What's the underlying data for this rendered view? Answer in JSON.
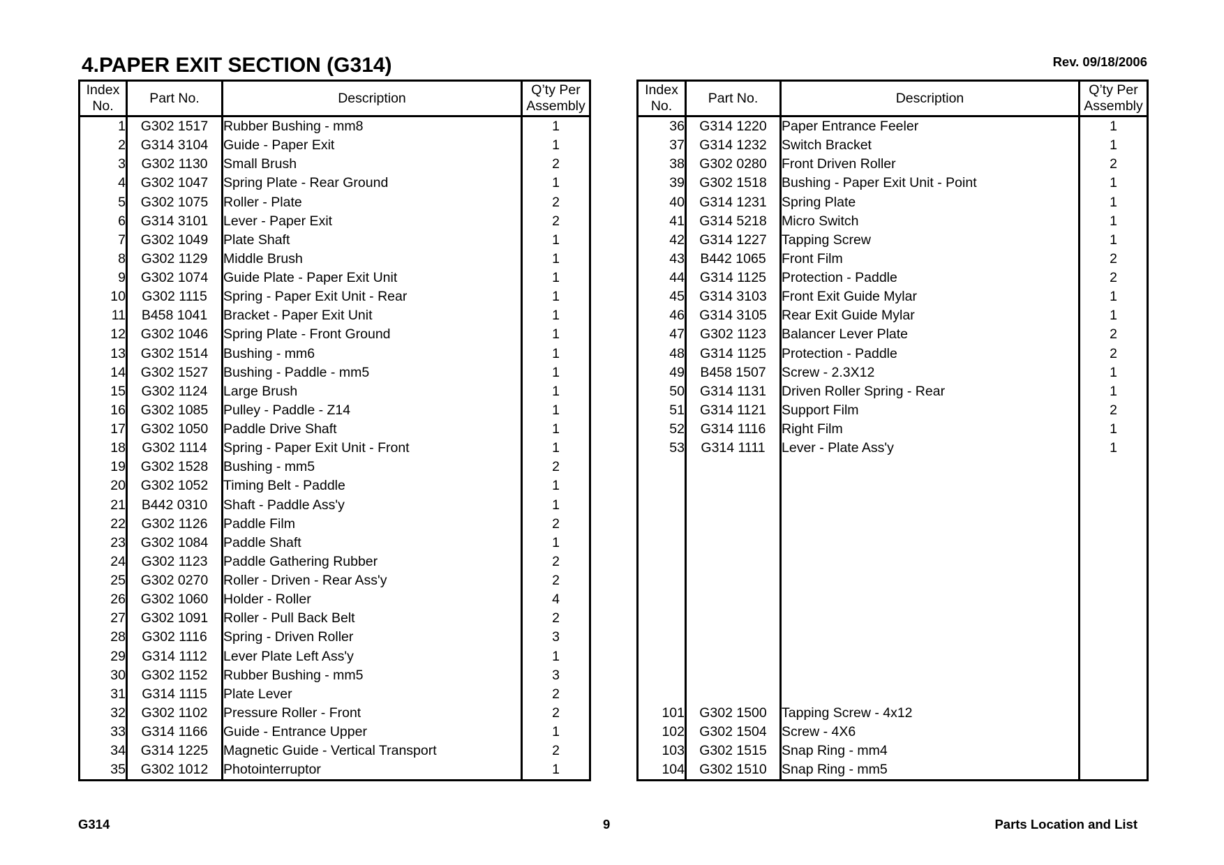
{
  "header": {
    "title": "4.PAPER EXIT SECTION (G314)",
    "revision": "Rev. 09/18/2006"
  },
  "columns": {
    "index": [
      "Index",
      "No."
    ],
    "part_no": "Part No.",
    "description": "Description",
    "qty": [
      "Q’ty Per",
      "Assembly"
    ]
  },
  "left_table": {
    "rows": [
      {
        "index": "1",
        "part_no": "G302 1517",
        "description": "Rubber Bushing - mm8",
        "qty": "1"
      },
      {
        "index": "2",
        "part_no": "G314 3104",
        "description": "Guide - Paper Exit",
        "qty": "1"
      },
      {
        "index": "3",
        "part_no": "G302 1130",
        "description": "Small Brush",
        "qty": "2"
      },
      {
        "index": "4",
        "part_no": "G302 1047",
        "description": "Spring Plate - Rear Ground",
        "qty": "1"
      },
      {
        "index": "5",
        "part_no": "G302 1075",
        "description": "Roller - Plate",
        "qty": "2"
      },
      {
        "index": "6",
        "part_no": "G314 3101",
        "description": "Lever - Paper Exit",
        "qty": "2"
      },
      {
        "index": "7",
        "part_no": "G302 1049",
        "description": "Plate Shaft",
        "qty": "1"
      },
      {
        "index": "8",
        "part_no": "G302 1129",
        "description": "Middle Brush",
        "qty": "1"
      },
      {
        "index": "9",
        "part_no": "G302 1074",
        "description": "Guide Plate - Paper Exit Unit",
        "qty": "1"
      },
      {
        "index": "10",
        "part_no": "G302 1115",
        "description": "Spring - Paper Exit Unit - Rear",
        "qty": "1"
      },
      {
        "index": "11",
        "part_no": "B458 1041",
        "description": "Bracket - Paper Exit Unit",
        "qty": "1"
      },
      {
        "index": "12",
        "part_no": "G302 1046",
        "description": "Spring Plate - Front Ground",
        "qty": "1"
      },
      {
        "index": "13",
        "part_no": "G302 1514",
        "description": "Bushing - mm6",
        "qty": "1"
      },
      {
        "index": "14",
        "part_no": "G302 1527",
        "description": "Bushing - Paddle - mm5",
        "qty": "1"
      },
      {
        "index": "15",
        "part_no": "G302 1124",
        "description": "Large Brush",
        "qty": "1"
      },
      {
        "index": "16",
        "part_no": "G302 1085",
        "description": "Pulley - Paddle - Z14",
        "qty": "1"
      },
      {
        "index": "17",
        "part_no": "G302 1050",
        "description": "Paddle Drive Shaft",
        "qty": "1"
      },
      {
        "index": "18",
        "part_no": "G302 1114",
        "description": "Spring - Paper Exit Unit - Front",
        "qty": "1"
      },
      {
        "index": "19",
        "part_no": "G302 1528",
        "description": "Bushing - mm5",
        "qty": "2"
      },
      {
        "index": "20",
        "part_no": "G302 1052",
        "description": "Timing Belt - Paddle",
        "qty": "1"
      },
      {
        "index": "21",
        "part_no": "B442 0310",
        "description": "Shaft - Paddle Ass'y",
        "qty": "1"
      },
      {
        "index": "22",
        "part_no": "G302 1126",
        "description": "Paddle Film",
        "qty": "2"
      },
      {
        "index": "23",
        "part_no": "G302 1084",
        "description": "Paddle Shaft",
        "qty": "1"
      },
      {
        "index": "24",
        "part_no": "G302 1123",
        "description": "Paddle Gathering Rubber",
        "qty": "2"
      },
      {
        "index": "25",
        "part_no": "G302 0270",
        "description": "Roller - Driven - Rear Ass'y",
        "qty": "2"
      },
      {
        "index": "26",
        "part_no": "G302 1060",
        "description": "Holder - Roller",
        "qty": "4"
      },
      {
        "index": "27",
        "part_no": "G302 1091",
        "description": "Roller - Pull Back Belt",
        "qty": "2"
      },
      {
        "index": "28",
        "part_no": "G302 1116",
        "description": "Spring - Driven Roller",
        "qty": "3"
      },
      {
        "index": "29",
        "part_no": "G314 1112",
        "description": "Lever Plate Left Ass'y",
        "qty": "1"
      },
      {
        "index": "30",
        "part_no": "G302 1152",
        "description": "Rubber Bushing - mm5",
        "qty": "3"
      },
      {
        "index": "31",
        "part_no": "G314 1115",
        "description": "Plate Lever",
        "qty": "2"
      },
      {
        "index": "32",
        "part_no": "G302 1102",
        "description": "Pressure Roller - Front",
        "qty": "2"
      },
      {
        "index": "33",
        "part_no": "G314 1166",
        "description": "Guide - Entrance Upper",
        "qty": "1"
      },
      {
        "index": "34",
        "part_no": "G314 1225",
        "description": "Magnetic Guide - Vertical Transport",
        "qty": "2"
      },
      {
        "index": "35",
        "part_no": "G302 1012",
        "description": "Photointerruptor",
        "qty": "1"
      }
    ]
  },
  "right_table": {
    "rows": [
      {
        "index": "36",
        "part_no": "G314 1220",
        "description": "Paper Entrance Feeler",
        "qty": "1"
      },
      {
        "index": "37",
        "part_no": "G314 1232",
        "description": "Switch Bracket",
        "qty": "1"
      },
      {
        "index": "38",
        "part_no": "G302 0280",
        "description": "Front Driven Roller",
        "qty": "2"
      },
      {
        "index": "39",
        "part_no": "G302 1518",
        "description": "Bushing - Paper Exit Unit - Point",
        "qty": "1"
      },
      {
        "index": "40",
        "part_no": "G314 1231",
        "description": "Spring Plate",
        "qty": "1"
      },
      {
        "index": "41",
        "part_no": "G314 5218",
        "description": "Micro Switch",
        "qty": "1"
      },
      {
        "index": "42",
        "part_no": "G314 1227",
        "description": "Tapping Screw",
        "qty": "1"
      },
      {
        "index": "43",
        "part_no": "B442 1065",
        "description": "Front Film",
        "qty": "2"
      },
      {
        "index": "44",
        "part_no": "G314 1125",
        "description": "Protection - Paddle",
        "qty": "2"
      },
      {
        "index": "45",
        "part_no": "G314 3103",
        "description": "Front Exit Guide Mylar",
        "qty": "1"
      },
      {
        "index": "46",
        "part_no": "G314 3105",
        "description": "Rear Exit Guide Mylar",
        "qty": "1"
      },
      {
        "index": "47",
        "part_no": "G302 1123",
        "description": "Balancer Lever Plate",
        "qty": "2"
      },
      {
        "index": "48",
        "part_no": "G314 1125",
        "description": "Protection - Paddle",
        "qty": "2"
      },
      {
        "index": "49",
        "part_no": "B458 1507",
        "description": "Screw - 2.3X12",
        "qty": "1"
      },
      {
        "index": "50",
        "part_no": "G314 1131",
        "description": "Driven Roller Spring - Rear",
        "qty": "1"
      },
      {
        "index": "51",
        "part_no": "G314 1121",
        "description": "Support Film",
        "qty": "2"
      },
      {
        "index": "52",
        "part_no": "G314 1116",
        "description": "Right Film",
        "qty": "1"
      },
      {
        "index": "53",
        "part_no": "G314 1111",
        "description": "Lever - Plate Ass'y",
        "qty": "1"
      }
    ],
    "blank_rows": 13,
    "screw_rows": [
      {
        "index": "101",
        "part_no": "G302 1500",
        "description": "Tapping Screw - 4x12",
        "qty": ""
      },
      {
        "index": "102",
        "part_no": "G302 1504",
        "description": "Screw - 4X6",
        "qty": ""
      },
      {
        "index": "103",
        "part_no": "G302 1515",
        "description": "Snap Ring - mm4",
        "qty": ""
      },
      {
        "index": "104",
        "part_no": "G302 1510",
        "description": "Snap Ring - mm5",
        "qty": ""
      }
    ]
  },
  "footer": {
    "model": "G314",
    "page_number": "9",
    "section": "Parts Location and List"
  }
}
